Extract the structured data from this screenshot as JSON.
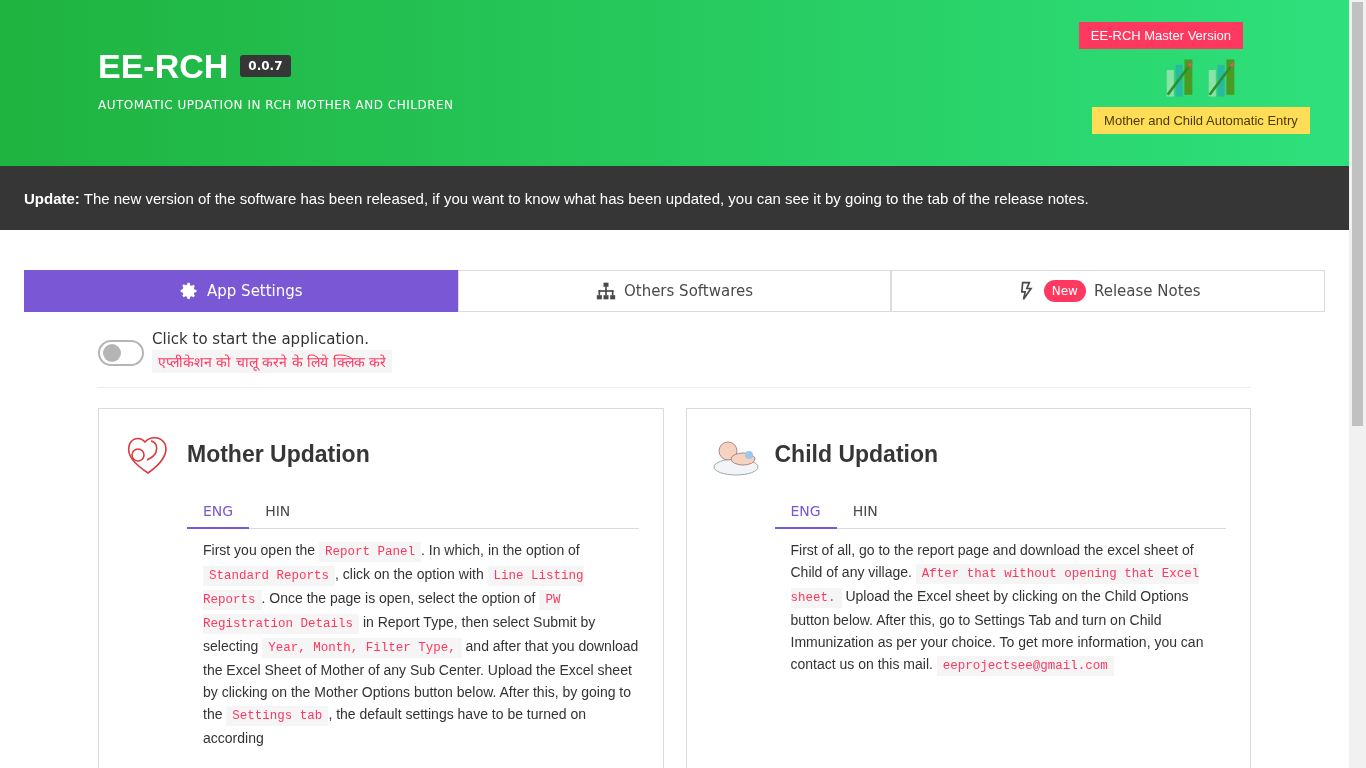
{
  "header": {
    "title": "EE-RCH",
    "version": "0.0.7",
    "subtitle": "AUTOMATIC UPDATION IN RCH MOTHER AND CHILDREN",
    "master_tooltip": "EE-RCH Master Version",
    "entry_tooltip": "Mother and Child Automatic Entry"
  },
  "announcement": {
    "label": "Update:",
    "text": "The new version of the software has been released, if you want to know what has been updated, you can see it by going to the tab of the release notes."
  },
  "tabs": [
    {
      "label": "App Settings",
      "selected": true
    },
    {
      "label": "Others Softwares",
      "selected": false
    },
    {
      "label": "Release Notes",
      "selected": false,
      "badge": "New"
    }
  ],
  "toggle": {
    "on": false,
    "label": "Click to start the application.",
    "hint": "एप्लीकेशन को चालू करने के लिये क्लिक करे"
  },
  "cards": [
    {
      "title": "Mother Updation",
      "lang_tabs": [
        {
          "label": "ENG",
          "selected": true
        },
        {
          "label": "HIN",
          "selected": false
        }
      ],
      "paragraph": [
        {
          "kind": "text",
          "text": "First you open the "
        },
        {
          "kind": "code",
          "text": "Report Panel"
        },
        {
          "kind": "text",
          "text": ". In which, in the option of "
        },
        {
          "kind": "code",
          "text": "Standard Reports"
        },
        {
          "kind": "text",
          "text": ", click on the option with "
        },
        {
          "kind": "code",
          "text": "Line Listing Reports"
        },
        {
          "kind": "text",
          "text": ". Once the page is open, select the option of "
        },
        {
          "kind": "code",
          "text": "PW Registration Details"
        },
        {
          "kind": "text",
          "text": " in Report Type, then select Submit by selecting "
        },
        {
          "kind": "code",
          "text": "Year, Month, Filter Type,"
        },
        {
          "kind": "text",
          "text": " and after that you download the Excel Sheet of Mother of any Sub Center. Upload the Excel sheet by clicking on the Mother Options button below. After this, by going to the "
        },
        {
          "kind": "code",
          "text": "Settings tab"
        },
        {
          "kind": "text",
          "text": ", the default settings have to be turned on according"
        }
      ]
    },
    {
      "title": "Child Updation",
      "lang_tabs": [
        {
          "label": "ENG",
          "selected": true
        },
        {
          "label": "HIN",
          "selected": false
        }
      ],
      "paragraph": [
        {
          "kind": "text",
          "text": "First of all, go to the report page and download the excel sheet of Child of any village. "
        },
        {
          "kind": "code",
          "text": "After that without opening that Excel sheet."
        },
        {
          "kind": "text",
          "text": " Upload the Excel sheet by clicking on the Child Options button below. After this, go to Settings Tab and turn on Child Immunization as per your choice. To get more information, you can contact us on this mail. "
        },
        {
          "kind": "code",
          "text": "eeprojectsee@gmail.com"
        }
      ]
    }
  ]
}
